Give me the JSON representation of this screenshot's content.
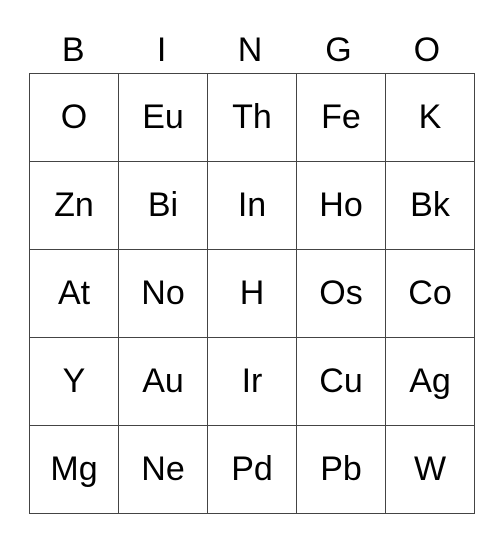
{
  "header": [
    "B",
    "I",
    "N",
    "G",
    "O"
  ],
  "rows": [
    [
      "O",
      "Eu",
      "Th",
      "Fe",
      "K"
    ],
    [
      "Zn",
      "Bi",
      "In",
      "Ho",
      "Bk"
    ],
    [
      "At",
      "No",
      "H",
      "Os",
      "Co"
    ],
    [
      "Y",
      "Au",
      "Ir",
      "Cu",
      "Ag"
    ],
    [
      "Mg",
      "Ne",
      "Pd",
      "Pb",
      "W"
    ]
  ]
}
